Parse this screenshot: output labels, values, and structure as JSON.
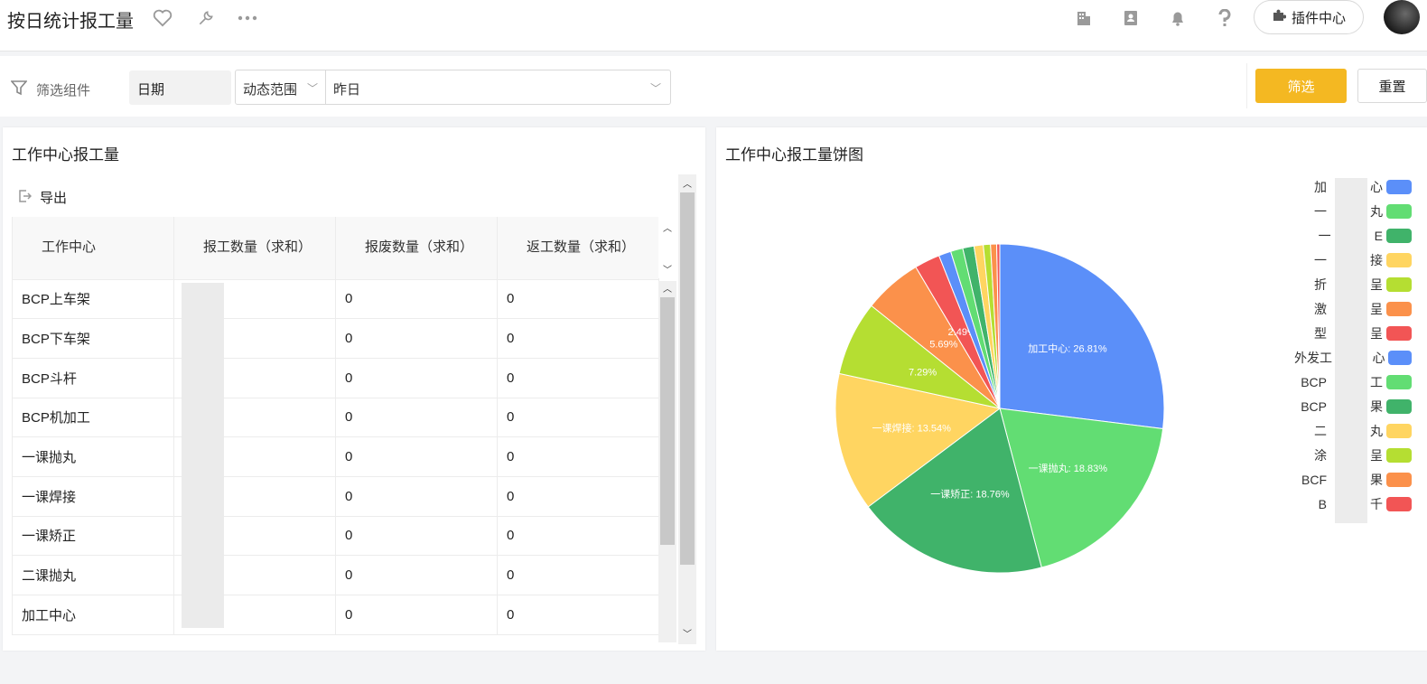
{
  "header": {
    "title": "按日统计报工量",
    "plugin_label": "插件中心"
  },
  "filter": {
    "label": "筛选组件",
    "field": "日期",
    "range_type": "动态范围",
    "range_value": "昨日",
    "filter_button": "筛选",
    "reset_button": "重置"
  },
  "table_panel": {
    "title": "工作中心报工量",
    "export_label": "导出",
    "columns": [
      "工作中心",
      "报工数量（求和）",
      "报废数量（求和）",
      "返工数量（求和）"
    ],
    "rows": [
      [
        "BCP上车架",
        "",
        "0",
        "0"
      ],
      [
        "BCP下车架",
        "",
        "0",
        "0"
      ],
      [
        "BCP斗杆",
        "",
        "0",
        "0"
      ],
      [
        "BCP机加工",
        "",
        "0",
        "0"
      ],
      [
        "一课抛丸",
        "",
        "0",
        "0"
      ],
      [
        "一课焊接",
        "",
        "0",
        "0"
      ],
      [
        "一课矫正",
        "",
        "0",
        "0"
      ],
      [
        "二课抛丸",
        "",
        "0",
        "0"
      ],
      [
        "加工中心",
        "",
        "0",
        "0"
      ]
    ]
  },
  "pie_panel": {
    "title": "工作中心报工量饼图"
  },
  "chart_data": {
    "type": "pie",
    "title": "工作中心报工量饼图",
    "slices": [
      {
        "label": "加工中心",
        "value": 26.81,
        "color": "#5b8ff9",
        "text": "加工中心: 26.81%"
      },
      {
        "label": "一课抛丸",
        "value": 18.83,
        "color": "#62dd73",
        "text": "一课抛丸: 18.83%"
      },
      {
        "label": "一课矫正",
        "value": 18.76,
        "color": "#40b36a",
        "text": "一课矫正: 18.76%"
      },
      {
        "label": "一课焊接",
        "value": 13.54,
        "color": "#ffd561",
        "text": "一课焊接: 13.54%"
      },
      {
        "label": "",
        "value": 7.29,
        "color": "#b5de32",
        "text": "7.29%"
      },
      {
        "label": "",
        "value": 5.69,
        "color": "#fb914b",
        "text": "5.69%"
      },
      {
        "label": "",
        "value": 2.49,
        "color": "#f25555",
        "text": "2.49%"
      },
      {
        "label": "外发工",
        "value": 1.2,
        "color": "#5b8ff9",
        "text": ""
      },
      {
        "label": "BCP",
        "value": 1.2,
        "color": "#62dd73",
        "text": ""
      },
      {
        "label": "BCP",
        "value": 1.1,
        "color": "#40b36a",
        "text": ""
      },
      {
        "label": "",
        "value": 0.9,
        "color": "#ffd561",
        "text": ""
      },
      {
        "label": "",
        "value": 0.7,
        "color": "#b5de32",
        "text": ""
      },
      {
        "label": "BCP",
        "value": 0.6,
        "color": "#fb914b",
        "text": ""
      },
      {
        "label": "",
        "value": 0.3,
        "color": "#f25555",
        "text": ""
      }
    ],
    "legend": [
      {
        "text": "加",
        "tail": "心",
        "color": "#5b8ff9"
      },
      {
        "text": "一",
        "tail": "丸",
        "color": "#62dd73"
      },
      {
        "text": "一",
        "tail": "E",
        "color": "#40b36a"
      },
      {
        "text": "一",
        "tail": "接",
        "color": "#ffd561"
      },
      {
        "text": "折",
        "tail": "呈",
        "color": "#b5de32"
      },
      {
        "text": "激",
        "tail": "呈",
        "color": "#fb914b"
      },
      {
        "text": "型",
        "tail": "呈",
        "color": "#f25555"
      },
      {
        "text": "外发工",
        "tail": "心",
        "color": "#5b8ff9"
      },
      {
        "text": "BCP",
        "tail": "工",
        "color": "#62dd73"
      },
      {
        "text": "BCP",
        "tail": "果",
        "color": "#40b36a"
      },
      {
        "text": "二",
        "tail": "丸",
        "color": "#ffd561"
      },
      {
        "text": "涂",
        "tail": "呈",
        "color": "#b5de32"
      },
      {
        "text": "BCF",
        "tail": "果",
        "color": "#fb914b"
      },
      {
        "text": "B",
        "tail": "千",
        "color": "#f25555"
      }
    ]
  }
}
